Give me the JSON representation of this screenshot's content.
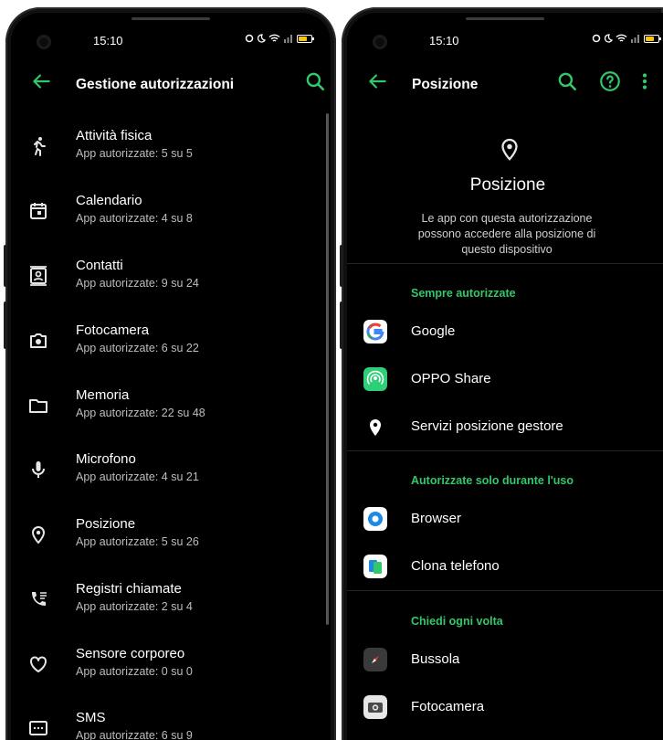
{
  "theme": {
    "accent": "#34c76a",
    "background": "#000000",
    "text": "#ffffff",
    "subtext": "#bdbdbd",
    "battery": "#f5c518"
  },
  "left_screen": {
    "status_bar": {
      "time": "15:10",
      "icons": [
        "data-saver-icon",
        "do-not-disturb-icon",
        "wifi-icon",
        "signal-icon",
        "battery-icon"
      ]
    },
    "top_bar": {
      "title": "Gestione autorizzazioni",
      "back_icon": "arrow-back-icon",
      "search_icon": "search-icon"
    },
    "permissions": [
      {
        "title": "Attività fisica",
        "subtitle": "App autorizzate: 5 su 5",
        "icon": "running-person-icon"
      },
      {
        "title": "Calendario",
        "subtitle": "App autorizzate: 4 su 8",
        "icon": "calendar-icon"
      },
      {
        "title": "Contatti",
        "subtitle": "App autorizzate: 9 su 24",
        "icon": "contacts-icon"
      },
      {
        "title": "Fotocamera",
        "subtitle": "App autorizzate: 6 su 22",
        "icon": "camera-icon"
      },
      {
        "title": "Memoria",
        "subtitle": "App autorizzate: 22 su 48",
        "icon": "folder-icon"
      },
      {
        "title": "Microfono",
        "subtitle": "App autorizzate: 4 su 21",
        "icon": "microphone-icon"
      },
      {
        "title": "Posizione",
        "subtitle": "App autorizzate: 5 su 26",
        "icon": "location-pin-icon"
      },
      {
        "title": "Registri chiamate",
        "subtitle": "App autorizzate: 2 su 4",
        "icon": "call-log-icon"
      },
      {
        "title": "Sensore corporeo",
        "subtitle": "App autorizzate: 0 su 0",
        "icon": "heart-icon"
      },
      {
        "title": "SMS",
        "subtitle": "App autorizzate: 6 su 9",
        "icon": "sms-icon"
      }
    ]
  },
  "right_screen": {
    "status_bar": {
      "time": "15:10",
      "icons": [
        "data-saver-icon",
        "do-not-disturb-icon",
        "wifi-icon",
        "signal-icon",
        "battery-icon"
      ]
    },
    "top_bar": {
      "title": "Posizione",
      "back_icon": "arrow-back-icon",
      "search_icon": "search-icon",
      "help_icon": "help-icon",
      "more_icon": "more-vert-icon"
    },
    "header": {
      "icon": "location-pin-icon",
      "title": "Posizione",
      "description": "Le app con questa autorizzazione possono accedere alla posizione di questo dispositivo"
    },
    "sections": [
      {
        "header": "Sempre autorizzate",
        "apps": [
          {
            "name": "Google",
            "icon": "google-app-icon"
          },
          {
            "name": "OPPO Share",
            "icon": "oppo-share-app-icon"
          },
          {
            "name": "Servizi posizione gestore",
            "icon": "location-pin-icon"
          }
        ]
      },
      {
        "header": "Autorizzate solo durante l'uso",
        "apps": [
          {
            "name": "Browser",
            "icon": "browser-app-icon"
          },
          {
            "name": "Clona telefono",
            "icon": "clone-phone-app-icon"
          }
        ]
      },
      {
        "header": "Chiedi ogni volta",
        "apps": [
          {
            "name": "Bussola",
            "icon": "compass-app-icon"
          },
          {
            "name": "Fotocamera",
            "icon": "camera-app-icon"
          }
        ]
      }
    ]
  }
}
